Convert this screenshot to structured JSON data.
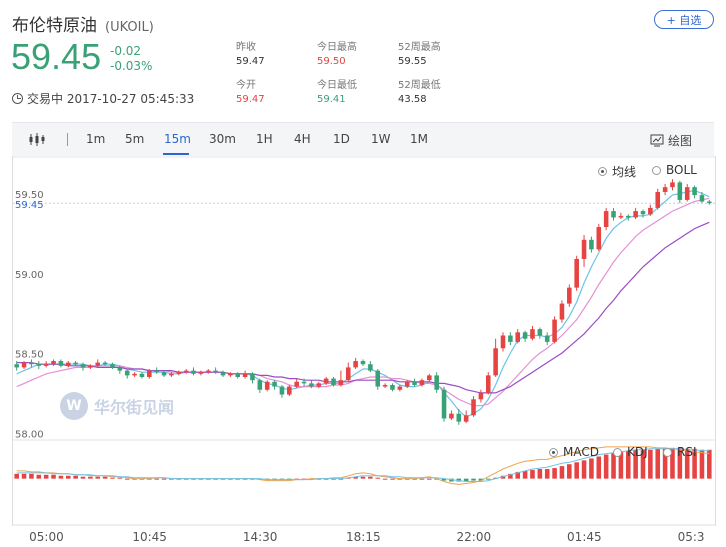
{
  "header": {
    "name": "布伦特原油",
    "symbol": "(UKOIL)",
    "favorite_label": "+ 自选",
    "price": "59.45",
    "change": "-0.02",
    "change_pct": "-0.03%",
    "status": "交易中 2017-10-27 05:45:33"
  },
  "stats": [
    {
      "label": "昨收",
      "value": "59.47"
    },
    {
      "label": "今日最高",
      "value": "59.50"
    },
    {
      "label": "52周最高",
      "value": "59.55"
    },
    {
      "label": "今开",
      "value": "59.47"
    },
    {
      "label": "今日最低",
      "value": "59.41"
    },
    {
      "label": "52周最低",
      "value": "43.58"
    }
  ],
  "toolbar": {
    "intervals": [
      "1m",
      "5m",
      "15m",
      "30m",
      "1H",
      "4H",
      "1D",
      "1W",
      "1M"
    ],
    "active": "15m",
    "draw_label": "绘图"
  },
  "indicators_main": [
    {
      "label": "均线",
      "selected": true
    },
    {
      "label": "BOLL",
      "selected": false
    }
  ],
  "indicators_sub": [
    {
      "label": "MACD",
      "selected": true
    },
    {
      "label": "KDJ",
      "selected": false
    },
    {
      "label": "RSI",
      "selected": false
    }
  ],
  "watermark": "华尔街见闻",
  "colors": {
    "up": "#e64343",
    "down": "#3aa176",
    "accent": "#2e66d0",
    "ma1": "#6ec3e8",
    "ma2": "#e58fd6",
    "ma3": "#9a4cc4",
    "price_line": "#2e66d0"
  },
  "chart_data": {
    "type": "candlestick",
    "y_ticks": [
      "59.50",
      "59.00",
      "58.50",
      "58.00"
    ],
    "y_tick_values": [
      59.5,
      59.0,
      58.5,
      58.0
    ],
    "last_price_label": "59.45",
    "last_price": 59.45,
    "ylim": [
      57.99,
      59.62
    ],
    "x_ticks": [
      "05:00",
      "10:45",
      "14:30",
      "18:15",
      "22:00",
      "01:45",
      "05:3"
    ],
    "x_tick_index": [
      4,
      18,
      33,
      47,
      62,
      77,
      92
    ],
    "candles": [
      [
        58.44,
        58.42,
        58.46,
        58.4
      ],
      [
        58.42,
        58.45,
        58.46,
        58.41
      ],
      [
        58.45,
        58.44,
        58.47,
        58.42
      ],
      [
        58.44,
        58.43,
        58.46,
        58.41
      ],
      [
        58.43,
        58.44,
        58.46,
        58.42
      ],
      [
        58.44,
        58.46,
        58.47,
        58.43
      ],
      [
        58.46,
        58.43,
        58.47,
        58.42
      ],
      [
        58.43,
        58.45,
        58.46,
        58.42
      ],
      [
        58.45,
        58.44,
        58.46,
        58.43
      ],
      [
        58.44,
        58.42,
        58.45,
        58.4
      ],
      [
        58.42,
        58.43,
        58.44,
        58.41
      ],
      [
        58.43,
        58.45,
        58.47,
        58.42
      ],
      [
        58.45,
        58.44,
        58.46,
        58.43
      ],
      [
        58.44,
        58.42,
        58.45,
        58.41
      ],
      [
        58.42,
        58.4,
        58.43,
        58.38
      ],
      [
        58.4,
        58.37,
        58.41,
        58.35
      ],
      [
        58.37,
        58.38,
        58.39,
        58.36
      ],
      [
        58.38,
        58.36,
        58.39,
        58.35
      ],
      [
        58.36,
        58.4,
        58.41,
        58.35
      ],
      [
        58.4,
        58.39,
        58.42,
        58.38
      ],
      [
        58.39,
        58.37,
        58.4,
        58.36
      ],
      [
        58.37,
        58.38,
        58.39,
        58.36
      ],
      [
        58.38,
        58.39,
        58.4,
        58.37
      ],
      [
        58.39,
        58.4,
        58.41,
        58.38
      ],
      [
        58.4,
        58.38,
        58.42,
        58.37
      ],
      [
        58.38,
        58.39,
        58.4,
        58.37
      ],
      [
        58.39,
        58.4,
        58.41,
        58.38
      ],
      [
        58.4,
        58.39,
        58.42,
        58.38
      ],
      [
        58.39,
        58.37,
        58.4,
        58.36
      ],
      [
        58.37,
        58.38,
        58.39,
        58.36
      ],
      [
        58.38,
        58.36,
        58.39,
        58.35
      ],
      [
        58.36,
        58.38,
        58.4,
        58.35
      ],
      [
        58.38,
        58.34,
        58.39,
        58.32
      ],
      [
        58.34,
        58.28,
        58.35,
        58.26
      ],
      [
        58.28,
        58.33,
        58.34,
        58.27
      ],
      [
        58.33,
        58.3,
        58.34,
        58.28
      ],
      [
        58.3,
        58.25,
        58.31,
        58.23
      ],
      [
        58.25,
        58.3,
        58.31,
        58.24
      ],
      [
        58.3,
        58.33,
        58.35,
        58.29
      ],
      [
        58.33,
        58.32,
        58.35,
        58.3
      ],
      [
        58.32,
        58.3,
        58.34,
        58.29
      ],
      [
        58.3,
        58.32,
        58.33,
        58.29
      ],
      [
        58.32,
        58.35,
        58.36,
        58.31
      ],
      [
        58.35,
        58.31,
        58.36,
        58.3
      ],
      [
        58.31,
        58.34,
        58.4,
        58.3
      ],
      [
        58.34,
        58.42,
        58.45,
        58.33
      ],
      [
        58.42,
        58.46,
        58.48,
        58.41
      ],
      [
        58.46,
        58.44,
        58.47,
        58.43
      ],
      [
        58.44,
        58.4,
        58.46,
        58.39
      ],
      [
        58.4,
        58.3,
        58.41,
        58.28
      ],
      [
        58.3,
        58.31,
        58.32,
        58.29
      ],
      [
        58.31,
        58.28,
        58.32,
        58.27
      ],
      [
        58.28,
        58.3,
        58.31,
        58.27
      ],
      [
        58.3,
        58.33,
        58.34,
        58.29
      ],
      [
        58.33,
        58.31,
        58.35,
        58.3
      ],
      [
        58.31,
        58.34,
        58.35,
        58.3
      ],
      [
        58.34,
        58.37,
        58.38,
        58.33
      ],
      [
        58.37,
        58.28,
        58.39,
        58.26
      ],
      [
        58.28,
        58.1,
        58.3,
        58.08
      ],
      [
        58.1,
        58.13,
        58.15,
        58.09
      ],
      [
        58.13,
        58.08,
        58.16,
        58.06
      ],
      [
        58.08,
        58.12,
        58.15,
        58.07
      ],
      [
        58.12,
        58.22,
        58.24,
        58.11
      ],
      [
        58.22,
        58.26,
        58.28,
        58.2
      ],
      [
        58.26,
        58.37,
        58.39,
        58.25
      ],
      [
        58.37,
        58.54,
        58.6,
        58.36
      ],
      [
        58.54,
        58.62,
        58.64,
        58.52
      ],
      [
        58.62,
        58.58,
        58.64,
        58.56
      ],
      [
        58.58,
        58.64,
        58.66,
        58.57
      ],
      [
        58.64,
        58.6,
        58.65,
        58.58
      ],
      [
        58.6,
        58.66,
        58.68,
        58.59
      ],
      [
        58.66,
        58.62,
        58.67,
        58.6
      ],
      [
        58.62,
        58.58,
        58.64,
        58.56
      ],
      [
        58.58,
        58.72,
        58.74,
        58.57
      ],
      [
        58.72,
        58.82,
        58.84,
        58.7
      ],
      [
        58.82,
        58.92,
        58.94,
        58.8
      ],
      [
        58.92,
        59.1,
        59.12,
        58.9
      ],
      [
        59.1,
        59.22,
        59.25,
        59.05
      ],
      [
        59.22,
        59.16,
        59.24,
        59.14
      ],
      [
        59.16,
        59.3,
        59.32,
        59.15
      ],
      [
        59.3,
        59.4,
        59.42,
        59.28
      ],
      [
        59.4,
        59.36,
        59.42,
        59.34
      ],
      [
        59.36,
        59.37,
        59.39,
        59.35
      ],
      [
        59.37,
        59.36,
        59.38,
        59.34
      ],
      [
        59.36,
        59.4,
        59.42,
        59.35
      ],
      [
        59.4,
        59.38,
        59.41,
        59.36
      ],
      [
        59.38,
        59.42,
        59.44,
        59.37
      ],
      [
        59.42,
        59.52,
        59.54,
        59.41
      ],
      [
        59.52,
        59.55,
        59.57,
        59.5
      ],
      [
        59.55,
        59.58,
        59.6,
        59.53
      ],
      [
        59.58,
        59.47,
        59.59,
        59.45
      ],
      [
        59.47,
        59.55,
        59.57,
        59.46
      ],
      [
        59.55,
        59.5,
        59.56,
        59.48
      ],
      [
        59.5,
        59.46,
        59.52,
        59.45
      ],
      [
        59.46,
        59.45,
        59.47,
        59.44
      ]
    ],
    "series": [
      {
        "values": [
          58.38,
          58.4,
          58.42,
          58.44,
          58.44,
          58.44,
          58.44,
          58.44,
          58.44,
          58.44,
          58.43,
          58.43,
          58.44,
          58.44,
          58.43,
          58.41,
          58.4,
          58.39,
          58.39,
          58.39,
          58.39,
          58.38,
          58.38,
          58.39,
          58.39,
          58.39,
          58.39,
          58.39,
          58.39,
          58.38,
          58.38,
          58.38,
          58.37,
          58.34,
          58.32,
          58.31,
          58.29,
          58.28,
          58.29,
          58.3,
          58.31,
          58.31,
          58.32,
          58.32,
          58.32,
          58.35,
          58.38,
          58.41,
          58.41,
          58.39,
          58.37,
          58.34,
          58.31,
          58.3,
          58.3,
          58.31,
          58.33,
          58.32,
          58.26,
          58.21,
          58.15,
          58.11,
          58.13,
          58.16,
          58.22,
          58.31,
          58.42,
          58.51,
          58.59,
          58.62,
          58.62,
          58.62,
          58.61,
          58.63,
          58.67,
          58.74,
          58.83,
          58.95,
          59.05,
          59.14,
          59.23,
          59.29,
          59.33,
          59.36,
          59.37,
          59.37,
          59.38,
          59.42,
          59.46,
          59.5,
          59.51,
          59.52,
          59.53,
          59.51,
          59.49
        ]
      },
      {
        "values": [
          58.3,
          58.32,
          58.34,
          58.36,
          58.38,
          58.39,
          58.4,
          58.41,
          58.42,
          58.42,
          58.42,
          58.43,
          58.43,
          58.43,
          58.43,
          58.42,
          58.41,
          58.41,
          58.4,
          58.4,
          58.4,
          58.39,
          58.39,
          58.39,
          58.39,
          58.39,
          58.39,
          58.39,
          58.39,
          58.38,
          58.38,
          58.38,
          58.38,
          58.37,
          58.35,
          58.34,
          58.33,
          58.31,
          58.3,
          58.3,
          58.3,
          58.3,
          58.3,
          58.31,
          58.31,
          58.32,
          58.34,
          58.35,
          58.36,
          58.36,
          58.36,
          58.35,
          58.35,
          58.34,
          58.33,
          58.32,
          58.32,
          58.31,
          58.28,
          58.25,
          58.22,
          58.2,
          58.18,
          58.18,
          58.19,
          58.23,
          58.27,
          58.32,
          58.37,
          58.42,
          58.47,
          58.51,
          58.54,
          58.58,
          58.62,
          58.67,
          58.72,
          58.79,
          58.86,
          58.94,
          59.01,
          59.08,
          59.14,
          59.19,
          59.24,
          59.28,
          59.31,
          59.34,
          59.37,
          59.4,
          59.42,
          59.44,
          59.46,
          59.47,
          59.48
        ]
      },
      {
        "values": [
          58.45,
          58.45,
          58.45,
          58.44,
          58.44,
          58.44,
          58.44,
          58.43,
          58.43,
          58.43,
          58.43,
          58.42,
          58.42,
          58.42,
          58.42,
          58.41,
          58.41,
          58.41,
          58.4,
          58.4,
          58.4,
          58.4,
          58.39,
          58.39,
          58.39,
          58.39,
          58.39,
          58.39,
          58.39,
          58.38,
          58.38,
          58.38,
          58.38,
          58.37,
          58.37,
          58.36,
          58.36,
          58.35,
          58.35,
          58.34,
          58.34,
          58.34,
          58.33,
          58.33,
          58.33,
          58.33,
          58.34,
          58.34,
          58.34,
          58.34,
          58.34,
          58.34,
          58.33,
          58.33,
          58.33,
          58.33,
          58.33,
          58.32,
          58.32,
          58.31,
          58.3,
          58.28,
          58.27,
          58.26,
          58.26,
          58.26,
          58.28,
          58.3,
          58.33,
          58.36,
          58.39,
          58.42,
          58.45,
          58.48,
          58.51,
          58.55,
          58.59,
          58.63,
          58.68,
          58.73,
          58.79,
          58.84,
          58.9,
          58.95,
          59.0,
          59.05,
          59.09,
          59.13,
          59.17,
          59.2,
          59.23,
          59.26,
          59.29,
          59.31,
          59.33
        ]
      }
    ],
    "macd": {
      "bars": [
        0.05,
        0.05,
        0.05,
        0.04,
        0.04,
        0.04,
        0.03,
        0.03,
        0.03,
        0.02,
        0.02,
        0.02,
        0.02,
        0.01,
        0.01,
        0.0,
        -0.01,
        -0.01,
        -0.01,
        0.0,
        0.0,
        0.0,
        0.0,
        0.0,
        0.0,
        0.0,
        0.0,
        0.0,
        0.0,
        0.0,
        0.0,
        0.0,
        0.0,
        -0.01,
        -0.01,
        -0.01,
        -0.01,
        -0.01,
        0.0,
        0.0,
        0.0,
        0.0,
        0.0,
        0.0,
        0.0,
        0.01,
        0.02,
        0.02,
        0.02,
        0.01,
        0.0,
        0.0,
        0.0,
        0.0,
        0.0,
        0.0,
        0.0,
        -0.01,
        -0.02,
        -0.03,
        -0.03,
        -0.03,
        -0.02,
        -0.02,
        -0.01,
        0.01,
        0.03,
        0.05,
        0.07,
        0.08,
        0.09,
        0.1,
        0.1,
        0.11,
        0.13,
        0.15,
        0.17,
        0.19,
        0.21,
        0.23,
        0.25,
        0.27,
        0.28,
        0.29,
        0.3,
        0.3,
        0.3,
        0.31,
        0.32,
        0.32,
        0.32,
        0.31,
        0.31,
        0.3,
        0.3
      ],
      "dif": [
        0.08,
        0.08,
        0.07,
        0.07,
        0.06,
        0.06,
        0.05,
        0.05,
        0.04,
        0.04,
        0.03,
        0.03,
        0.03,
        0.02,
        0.02,
        0.01,
        0.0,
        0.0,
        0.0,
        0.01,
        0.01,
        0.0,
        0.0,
        0.0,
        0.0,
        0.0,
        0.0,
        0.0,
        0.0,
        0.0,
        0.0,
        0.0,
        0.0,
        -0.01,
        -0.02,
        -0.02,
        -0.02,
        -0.02,
        -0.01,
        -0.01,
        0.0,
        0.0,
        0.0,
        0.01,
        0.01,
        0.03,
        0.05,
        0.06,
        0.05,
        0.03,
        0.02,
        0.01,
        0.0,
        0.0,
        0.0,
        0.01,
        0.02,
        0.0,
        -0.03,
        -0.05,
        -0.06,
        -0.05,
        -0.04,
        -0.02,
        0.02,
        0.06,
        0.1,
        0.13,
        0.16,
        0.18,
        0.19,
        0.2,
        0.2,
        0.22,
        0.24,
        0.26,
        0.28,
        0.3,
        0.31,
        0.32,
        0.33,
        0.33,
        0.33,
        0.33,
        0.33,
        0.33,
        0.33,
        0.32,
        0.32,
        0.31,
        0.3,
        0.29,
        0.28,
        0.27,
        0.26
      ],
      "dea": [
        0.06,
        0.06,
        0.06,
        0.06,
        0.06,
        0.05,
        0.05,
        0.05,
        0.04,
        0.04,
        0.04,
        0.03,
        0.03,
        0.03,
        0.02,
        0.02,
        0.01,
        0.01,
        0.01,
        0.01,
        0.01,
        0.0,
        0.0,
        0.0,
        0.0,
        0.0,
        0.0,
        0.0,
        0.0,
        0.0,
        0.0,
        0.0,
        0.0,
        0.0,
        -0.01,
        -0.01,
        -0.01,
        -0.01,
        -0.01,
        -0.01,
        -0.01,
        0.0,
        0.0,
        0.0,
        0.0,
        0.01,
        0.02,
        0.03,
        0.03,
        0.03,
        0.03,
        0.02,
        0.02,
        0.01,
        0.01,
        0.01,
        0.01,
        0.01,
        0.0,
        -0.01,
        -0.02,
        -0.03,
        -0.03,
        -0.03,
        -0.02,
        0.0,
        0.02,
        0.04,
        0.06,
        0.08,
        0.1,
        0.11,
        0.12,
        0.14,
        0.16,
        0.17,
        0.19,
        0.21,
        0.23,
        0.25,
        0.26,
        0.27,
        0.28,
        0.29,
        0.3,
        0.3,
        0.31,
        0.31,
        0.31,
        0.31,
        0.31,
        0.3,
        0.3,
        0.29,
        0.29
      ]
    }
  }
}
